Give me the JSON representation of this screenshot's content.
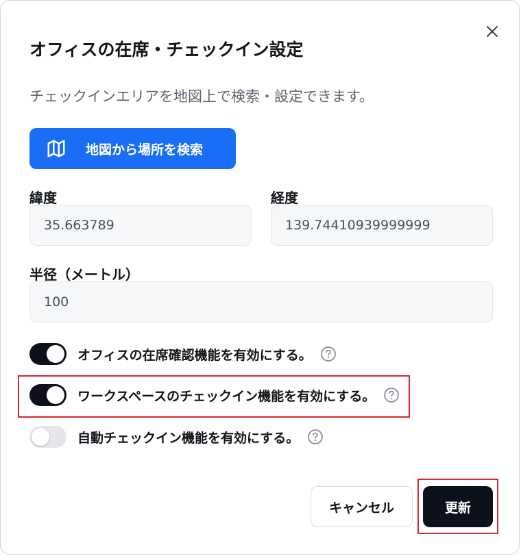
{
  "dialog": {
    "title": "オフィスの在席・チェックイン設定",
    "description": "チェックインエリアを地図上で検索・設定できます。",
    "close_icon": "close-icon"
  },
  "map_search": {
    "label": "地図から場所を検索",
    "icon": "map-icon",
    "color": "#1a6ef5"
  },
  "fields": {
    "latitude": {
      "label": "緯度",
      "value": "35.663789"
    },
    "longitude": {
      "label": "経度",
      "value": "139.74410939999999"
    },
    "radius": {
      "label": "半径（メートル）",
      "value": "100"
    }
  },
  "toggles": [
    {
      "label": "オフィスの在席確認機能を有効にする。",
      "enabled": true
    },
    {
      "label": "ワークスペースのチェックイン機能を有効にする。",
      "enabled": true
    },
    {
      "label": "自動チェックイン機能を有効にする。",
      "enabled": false
    }
  ],
  "footer": {
    "cancel_label": "キャンセル",
    "update_label": "更新"
  },
  "colors": {
    "primary_dark": "#0d111c",
    "highlight": "#d8262d",
    "toggle_off": "#e4e6ea"
  }
}
